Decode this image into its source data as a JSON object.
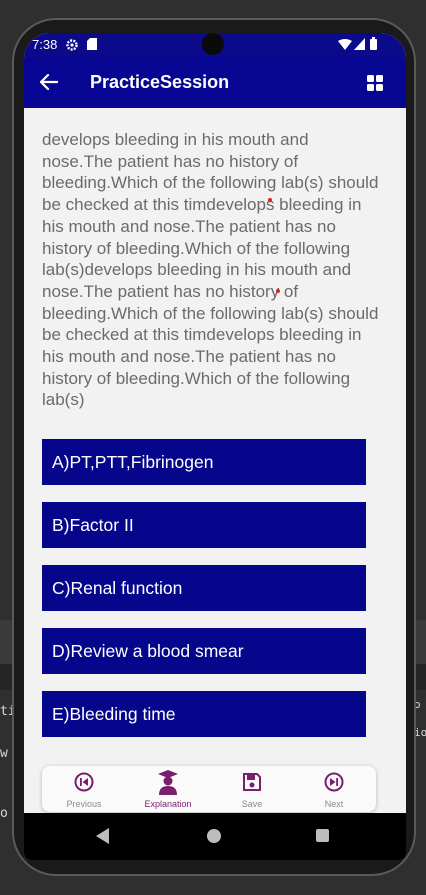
{
  "status_bar": {
    "time": "7:38"
  },
  "app_bar": {
    "title": "PracticeSession"
  },
  "question": {
    "text": "develops bleeding in his mouth and nose.The patient has no history of bleeding.Which of the following lab(s) should be checked at this timdevelops bleeding in his mouth and nose.The patient has no history of bleeding.Which of the following lab(s)develops bleeding in his mouth and nose.The patient has no history of bleeding.Which of the following lab(s) should be checked at this timdevelops bleeding in his mouth and nose.The patient has no history of bleeding.Which of the following lab(s)"
  },
  "options": [
    {
      "label": "A)PT,PTT,Fibrinogen"
    },
    {
      "label": "B)Factor II"
    },
    {
      "label": "C)Renal function"
    },
    {
      "label": "D)Review a blood smear"
    },
    {
      "label": "E)Bleeding time"
    }
  ],
  "bottom_nav": {
    "previous": "Previous",
    "explanation": "Explanation",
    "save": "Save",
    "next": "Next"
  },
  "background": {
    "fragment_1": "ti",
    "fragment_2": "w",
    "fragment_3": "o",
    "fragment_4": "o",
    "fragment_5": "io"
  },
  "colors": {
    "app_bar": "#070793",
    "option_bg": "#06068c",
    "nav_accent": "#7a1f6e",
    "text_gray": "#6b6b6b"
  }
}
